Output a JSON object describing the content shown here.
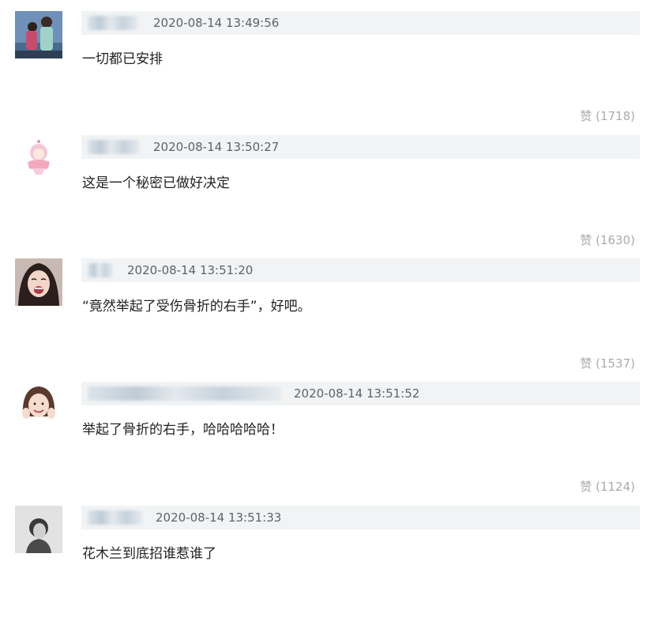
{
  "comments": [
    {
      "username_obscured": true,
      "timestamp": "2020-08-14 13:49:56",
      "text": "一切都已安排",
      "likes": "赞 (1718)",
      "avatar": "couple-photo"
    },
    {
      "username_obscured": true,
      "timestamp": "2020-08-14 13:50:27",
      "text": "这是一个秘密已做好决定",
      "likes": "赞 (1630)",
      "avatar": "cartoon-girl"
    },
    {
      "username_obscured": true,
      "timestamp": "2020-08-14 13:51:20",
      "text": "“竟然举起了受伤骨折的右手”，好吧。",
      "likes": "赞 (1537)",
      "avatar": "laughing-woman"
    },
    {
      "username_obscured": true,
      "timestamp": "2020-08-14 13:51:52",
      "text": "举起了骨折的右手，哈哈哈哈哈！",
      "likes": "赞 (1124)",
      "avatar": "smiling-woman"
    },
    {
      "username_obscured": true,
      "timestamp": "2020-08-14 13:51:33",
      "text": "花木兰到底招谁惹谁了",
      "likes": "",
      "avatar": "bw-portrait"
    }
  ],
  "colors": {
    "meta_bar": "#f1f3f4",
    "timestamp": "#5f6368",
    "text": "#222222",
    "likes": "#a8acb0"
  }
}
